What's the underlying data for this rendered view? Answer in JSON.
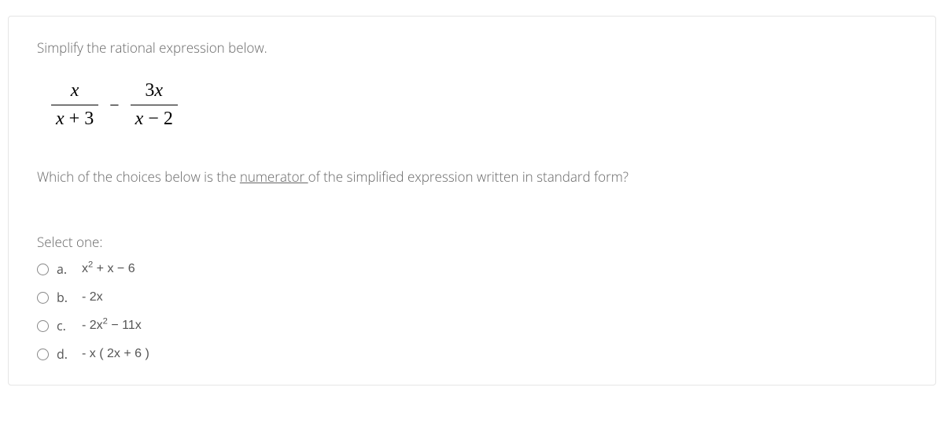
{
  "prompt": "Simplify the rational expression below.",
  "expression": {
    "frac1": {
      "num": "x",
      "den": "x + 3"
    },
    "op": "−",
    "frac2": {
      "num": "3x",
      "den": "x − 2"
    }
  },
  "question_prefix": "Which of the choices below is the ",
  "question_underlined": "numerator ",
  "question_suffix": "of the simplified expression written in standard form?",
  "select_label": "Select one:",
  "choices": [
    {
      "letter": "a.",
      "html": "x<sup>2</sup> + x − 6"
    },
    {
      "letter": "b.",
      "html": "- 2x"
    },
    {
      "letter": "c.",
      "html": "- 2x<sup>2</sup> − 11x"
    },
    {
      "letter": "d.",
      "html": "- x ( 2x + 6 )"
    }
  ]
}
